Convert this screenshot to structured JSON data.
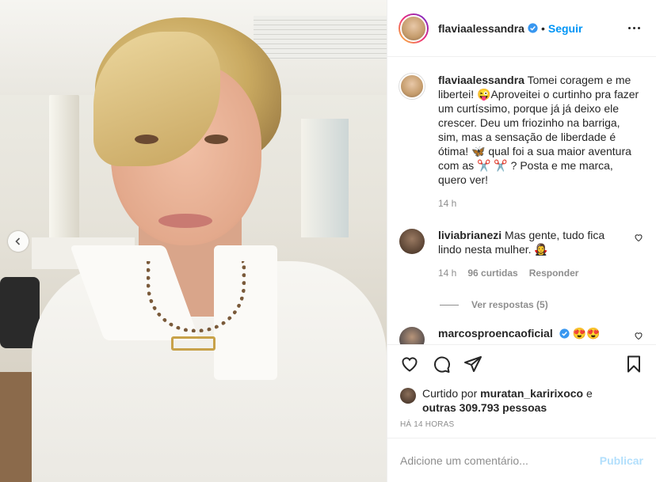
{
  "post": {
    "username": "flaviaalessandra",
    "follow_label": "Seguir",
    "separator": "•",
    "caption": "Tomei coragem e me libertei! 😜Aproveitei o curtinho pra fazer um curtíssimo, porque já já deixo ele crescer. Deu um friozinho na barriga, sim, mas a sensação de liberdade é ótima! 🦋 qual foi a sua maior aventura com as ✂️ ✂️ ? Posta e me marca, quero ver!",
    "caption_time": "14 h"
  },
  "comments": [
    {
      "username": "liviabrianezi",
      "text": "Mas gente, tudo fica lindo nesta mulher. 🧛‍♀️",
      "time": "14 h",
      "likes": "96 curtidas",
      "reply_label": "Responder",
      "view_replies": "Ver respostas (5)"
    },
    {
      "username": "marcosproencaoficial",
      "text": "😍😍"
    }
  ],
  "likes": {
    "prefix": "Curtido por",
    "user": "muratan_karirixoco",
    "connector": "e",
    "others": "outras 309.793 pessoas"
  },
  "timestamp": "HÁ 14 HORAS",
  "comment_box": {
    "placeholder": "Adicione um comentário...",
    "publish_label": "Publicar"
  },
  "icons": {
    "like": "heart-icon",
    "comment": "comment-icon",
    "share": "paper-plane-icon",
    "save": "bookmark-icon",
    "verified": "verified-badge-icon",
    "more": "more-options-icon",
    "prev": "chevron-left-icon"
  },
  "colors": {
    "accent": "#0095f6",
    "publish_disabled": "#b2dffc",
    "muted": "#8e8e8e"
  }
}
